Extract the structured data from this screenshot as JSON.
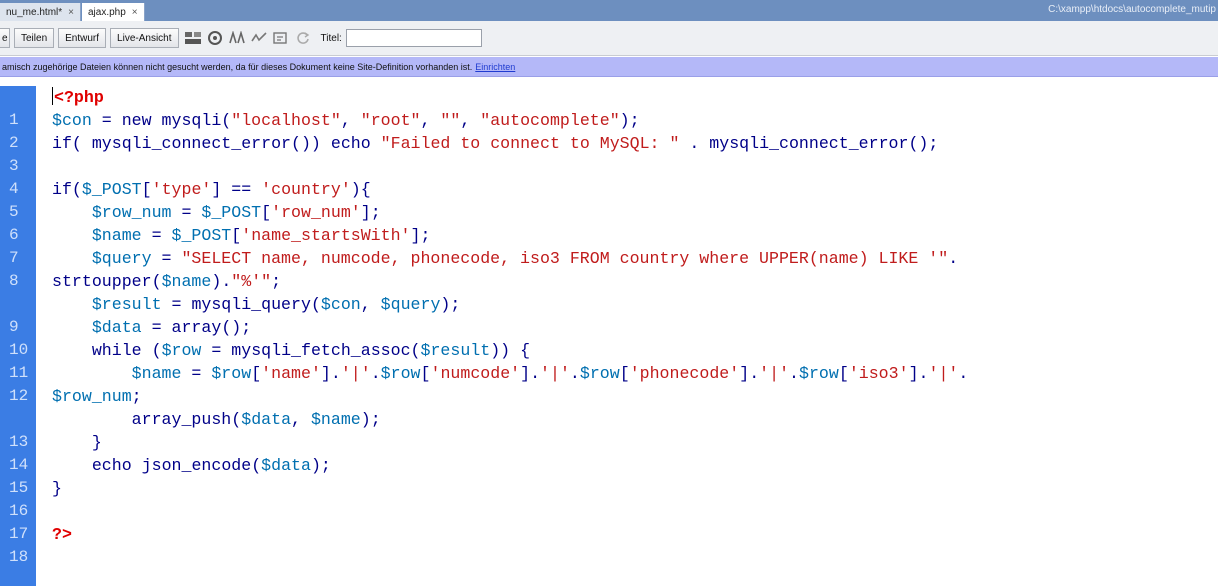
{
  "tabs": [
    {
      "label": "nu_me.html*",
      "close": "×",
      "active": false
    },
    {
      "label": "ajax.php",
      "close": "×",
      "active": true
    }
  ],
  "path": "C:\\xampp\\htdocs\\autocomplete_mutip",
  "toolbar": {
    "cut_label": "e",
    "code_label": "Teilen",
    "design_label": "Entwurf",
    "live_label": "Live-Ansicht",
    "title_label": "Titel:",
    "title_value": ""
  },
  "infobar": {
    "text": "amisch zugehörige Dateien können nicht gesucht werden, da für dieses Dokument keine Site-Definition vorhanden ist.",
    "link": "Einrichten"
  },
  "code": {
    "line_numbers": [
      "1",
      "2",
      "3",
      "4",
      "5",
      "6",
      "7",
      "8",
      "",
      "9",
      "10",
      "11",
      "12",
      "",
      "13",
      "14",
      "15",
      "16",
      "17",
      "18"
    ]
  },
  "colors": {
    "gutter": "#3b7de4",
    "keyword": "#000088",
    "variable": "#006fb0",
    "string": "#c01c1c",
    "php_tag": "#e00000"
  }
}
